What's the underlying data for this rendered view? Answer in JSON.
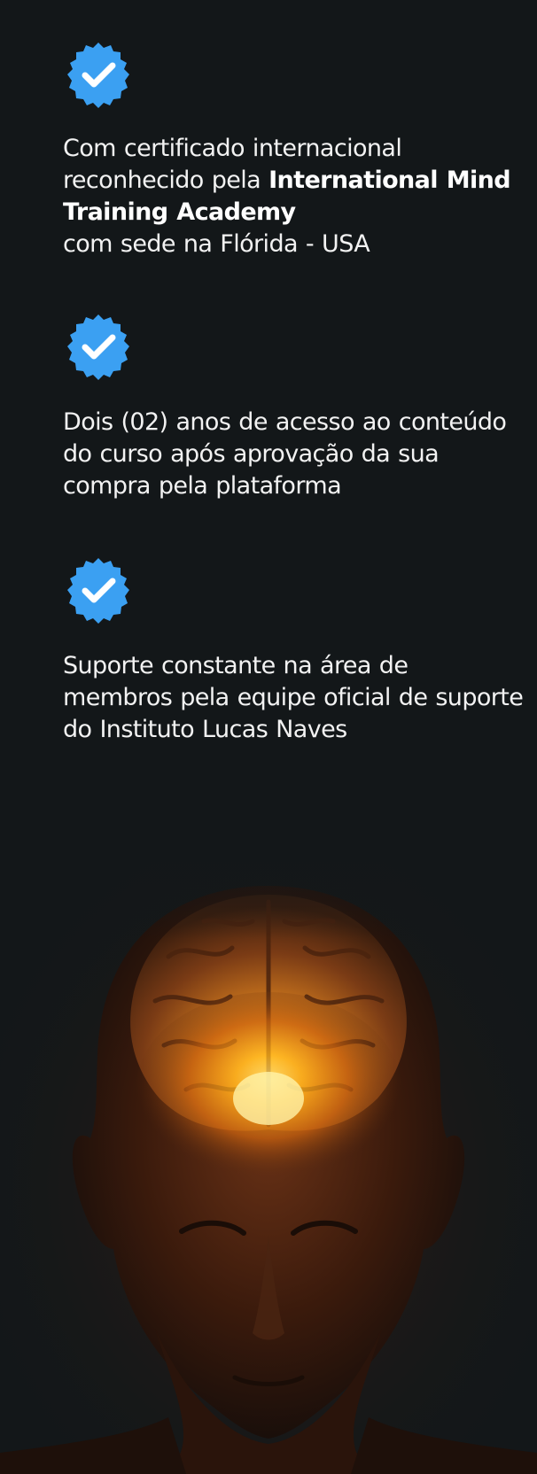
{
  "features": [
    {
      "icon": "verified-check-icon",
      "text_before": "Com certificado internacional reconhecido pela ",
      "text_bold": "International Mind Training Academy",
      "text_after": "com sede na Flórida - USA"
    },
    {
      "icon": "verified-check-icon",
      "text": "Dois (02) anos de acesso ao conteúdo do curso após aprovação da sua compra pela plataforma"
    },
    {
      "icon": "verified-check-icon",
      "text": "Suporte constante na área de membros pela equipe oficial de suporte do Instituto Lucas Naves"
    }
  ],
  "colors": {
    "background": "#131719",
    "badge": "#3ba0f2",
    "text": "#f2f2f2",
    "glow": "#ffb21a"
  },
  "illustration": "glowing-brain-head-image"
}
